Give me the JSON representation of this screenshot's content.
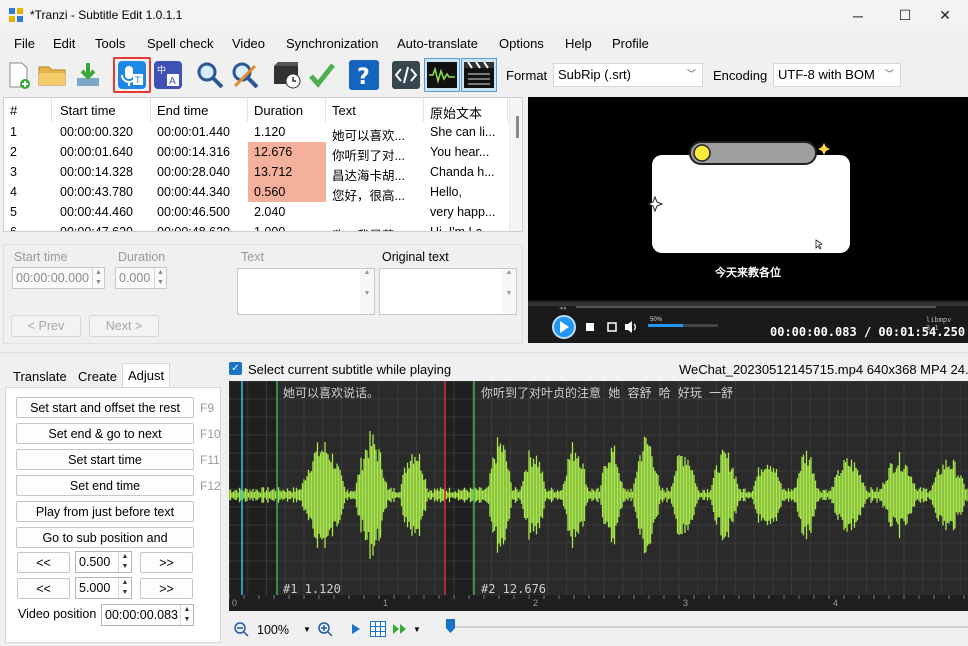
{
  "window": {
    "title": "*Tranzi - Subtitle Edit 1.0.1.1",
    "minimize": "─",
    "maximize": "☐",
    "close": "✕"
  },
  "menu": [
    "File",
    "Edit",
    "Tools",
    "Spell check",
    "Video",
    "Synchronization",
    "Auto-translate",
    "Options",
    "Help",
    "Profile"
  ],
  "toolbar": {
    "icons": [
      "new-file-icon",
      "open-folder-icon",
      "download-icon",
      "speech-to-text-icon",
      "translate-icon",
      "find-icon",
      "replace-icon",
      "visual-sync-icon",
      "spell-check-icon",
      "help-icon",
      "source-view-icon",
      "waveform-toggle-icon",
      "video-toggle-icon"
    ],
    "format_label": "Format",
    "format_value": "SubRip (.srt)",
    "encoding_label": "Encoding",
    "encoding_value": "UTF-8 with BOM"
  },
  "grid": {
    "columns": [
      "#",
      "Start time",
      "End time",
      "Duration",
      "Text",
      "原始文本"
    ],
    "rows": [
      {
        "num": "1",
        "start": "00:00:00.320",
        "end": "00:00:01.440",
        "duration": "1.120",
        "text": "她可以喜欢...",
        "original": "She can li...",
        "warn": false
      },
      {
        "num": "2",
        "start": "00:00:01.640",
        "end": "00:00:14.316",
        "duration": "12.676",
        "text": "你听到了对...",
        "original": "You hear...",
        "warn": true
      },
      {
        "num": "3",
        "start": "00:00:14.328",
        "end": "00:00:28.040",
        "duration": "13.712",
        "text": "昌达海卡胡...",
        "original": "Chanda h...",
        "warn": true
      },
      {
        "num": "4",
        "start": "00:00:43.780",
        "end": "00:00:44.340",
        "duration": "0.560",
        "text": "您好，很高...",
        "original": "Hello,",
        "warn": true
      },
      {
        "num": "5",
        "start": "00:00:44.460",
        "end": "00:00:46.500",
        "duration": "2.040",
        "text": "",
        "original": "very happ...",
        "warn": false
      },
      {
        "num": "6",
        "start": "00:00:47.620",
        "end": "00:00:48.620",
        "duration": "1.000",
        "text": "嗨，我是莎...",
        "original": "Hi, I'm La...",
        "warn": false
      }
    ]
  },
  "edit": {
    "start_time_label": "Start time",
    "start_time_value": "00:00:00.000",
    "duration_label": "Duration",
    "duration_value": "0.000",
    "text_label": "Text",
    "original_label": "Original text",
    "prev_button": "< Prev",
    "next_button": "Next >"
  },
  "video": {
    "caption": "今天来教各位",
    "time_current": "00:00:00.083",
    "time_separator": "/",
    "time_total": "00:01:54.250",
    "volume_label": "50%",
    "engine_label": "libmpv 3.1"
  },
  "tabs": [
    "Translate",
    "Create",
    "Adjust"
  ],
  "adjust": {
    "buttons": [
      {
        "label": "Set start and offset the rest",
        "shortcut": "F9"
      },
      {
        "label": "Set end & go to next",
        "shortcut": "F10"
      },
      {
        "label": "Set start time",
        "shortcut": "F11"
      },
      {
        "label": "Set end time",
        "shortcut": "F12"
      },
      {
        "label": "Play from just before text",
        "shortcut": ""
      },
      {
        "label": "Go to sub position and",
        "shortcut": ""
      }
    ],
    "rewind_label": "<<",
    "forward_label": ">>",
    "step1_value": "0.500",
    "step2_value": "5.000",
    "video_position_label": "Video position",
    "video_position_value": "00:00:00.083"
  },
  "waveform": {
    "select_current_label": "Select current subtitle while playing",
    "select_current_checked": true,
    "file_info": "WeChat_20230512145715.mp4 640x368 MP4 24.0",
    "sub1_text": "她可以喜欢说话。",
    "sub2_text": "你听到了对叶贞的注意 她 容舒 哈 好玩 一舒",
    "sub1_label": "#1  1.120",
    "sub2_label": "#2  12.676",
    "ticks": [
      "0",
      "1",
      "2",
      "3",
      "4"
    ],
    "wave_color": "#a8e84a"
  },
  "bottom": {
    "zoom_value": "100%"
  }
}
